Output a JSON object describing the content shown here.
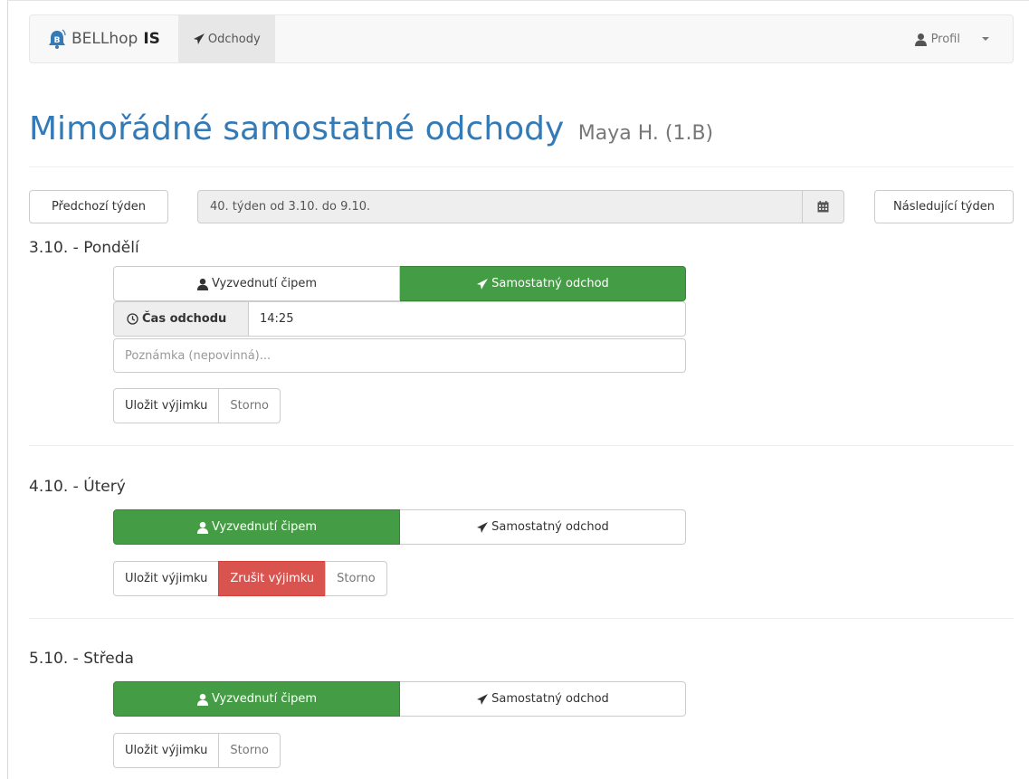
{
  "navbar": {
    "brand_text": "BELLhop",
    "brand_bold": "IS",
    "nav_item": "Odchody",
    "profile": "Profil"
  },
  "header": {
    "title": "Mimořádné samostatné odchody",
    "subtitle": "Maya H. (1.B)"
  },
  "week": {
    "prev": "Předchozí týden",
    "range": "40. týden od 3.10. do 9.10.",
    "next": "Následující týden"
  },
  "days": [
    {
      "title": "3.10. - Pondělí",
      "option_chip": "Vyzvednutí čipem",
      "option_alone": "Samostatný odchod",
      "selected": "alone",
      "time_label": "Čas odchodu",
      "time_value": "14:25",
      "note_placeholder": "Poznámka (nepovinná)...",
      "save": "Uložit výjimku",
      "cancel": "Storno"
    },
    {
      "title": "4.10. - Úterý",
      "option_chip": "Vyzvednutí čipem",
      "option_alone": "Samostatný odchod",
      "selected": "chip",
      "save": "Uložit výjimku",
      "delete": "Zrušit výjimku",
      "cancel": "Storno"
    },
    {
      "title": "5.10. - Středa",
      "option_chip": "Vyzvednutí čipem",
      "option_alone": "Samostatný odchod",
      "selected": "chip",
      "save": "Uložit výjimku",
      "cancel": "Storno"
    }
  ],
  "colors": {
    "primary": "#337ab7",
    "success": "#449d44",
    "danger": "#d9534f"
  },
  "icons": {
    "brand": "bell-icon",
    "nav": "paper-plane-icon",
    "profile": "user-icon",
    "calendar": "calendar-icon",
    "time": "clock-icon"
  }
}
